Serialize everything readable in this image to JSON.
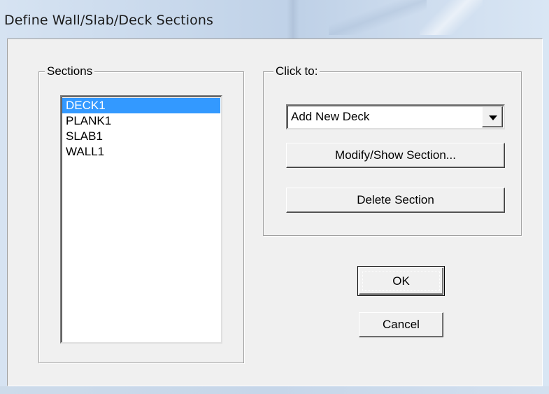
{
  "window": {
    "title": "Define Wall/Slab/Deck Sections"
  },
  "sections": {
    "label": "Sections",
    "items": [
      "DECK1",
      "PLANK1",
      "SLAB1",
      "WALL1"
    ],
    "selected": "DECK1"
  },
  "click_to": {
    "label": "Click to:",
    "dropdown_value": "Add New Deck",
    "modify_label": "Modify/Show Section...",
    "delete_label": "Delete Section"
  },
  "buttons": {
    "ok_label": "OK",
    "cancel_label": "Cancel"
  },
  "colors": {
    "selection": "#3399ff",
    "dialog_bg": "#f0f0f0"
  }
}
